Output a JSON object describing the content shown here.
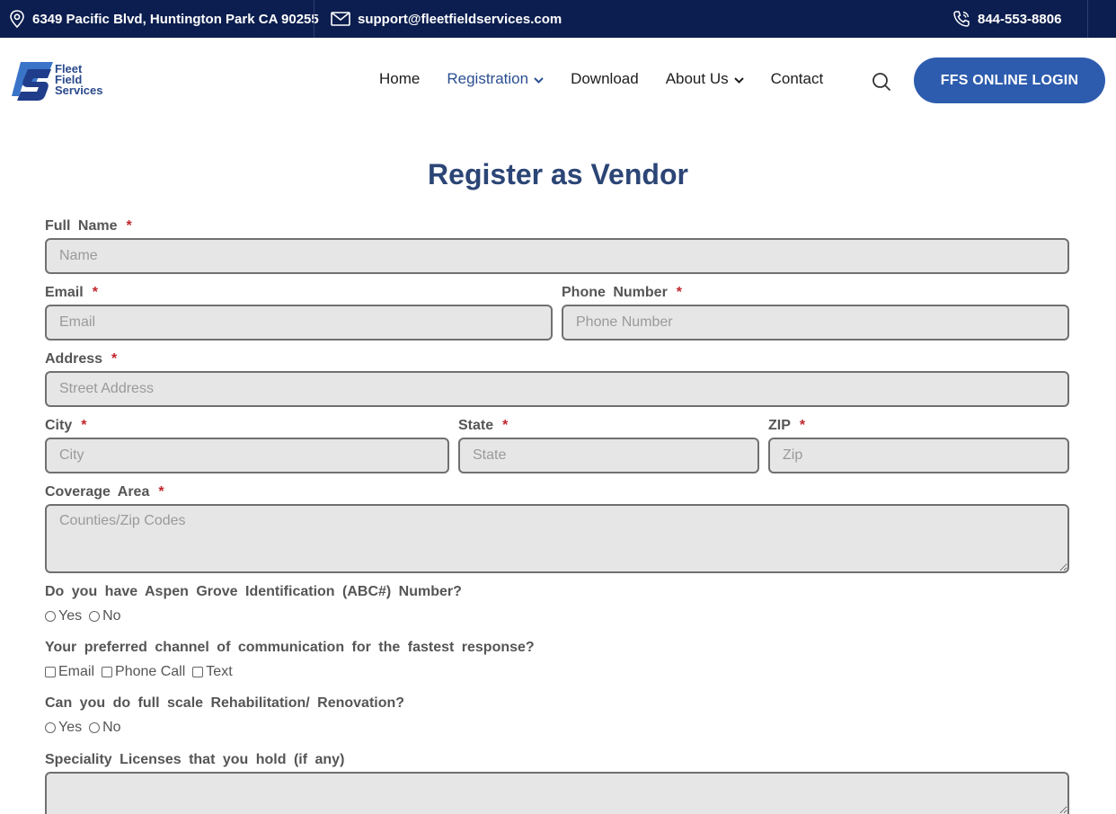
{
  "topbar": {
    "address": "6349 Pacific Blvd, Huntington Park CA 90255",
    "email": "support@fleetfieldservices.com",
    "phone": "844-553-8806"
  },
  "logo": {
    "line1": "Fleet",
    "line2": "Field",
    "line3": "Services"
  },
  "nav": {
    "items": [
      "Home",
      "Registration",
      "Download",
      "About Us",
      "Contact"
    ],
    "login": "FFS ONLINE LOGIN"
  },
  "form": {
    "title": "Register as Vendor",
    "full_name": {
      "label": "Full Name",
      "placeholder": "Name"
    },
    "email": {
      "label": "Email",
      "placeholder": "Email"
    },
    "phone": {
      "label": "Phone Number",
      "placeholder": "Phone Number"
    },
    "address": {
      "label": "Address",
      "placeholder": "Street Address"
    },
    "city": {
      "label": "City",
      "placeholder": "City"
    },
    "state": {
      "label": "State",
      "placeholder": "State"
    },
    "zip": {
      "label": "ZIP",
      "placeholder": "Zip"
    },
    "coverage": {
      "label": "Coverage Area",
      "placeholder": "Counties/Zip Codes"
    },
    "abc": {
      "label": "Do you have Aspen Grove Identification (ABC#) Number?",
      "options": [
        "Yes",
        "No"
      ]
    },
    "channel": {
      "label": "Your preferred channel of communication for the fastest response?",
      "options": [
        "Email",
        "Phone Call",
        "Text"
      ]
    },
    "rehab": {
      "label": "Can you do full scale Rehabilitation/ Renovation?",
      "options": [
        "Yes",
        "No"
      ]
    },
    "licenses": {
      "label": "Speciality Licenses that you hold (if any)"
    },
    "required_mark": "*"
  },
  "colors": {
    "topbar": "#0c1e4f",
    "accent": "#2d5cae",
    "title": "#2b4575",
    "required": "#c0262c"
  }
}
